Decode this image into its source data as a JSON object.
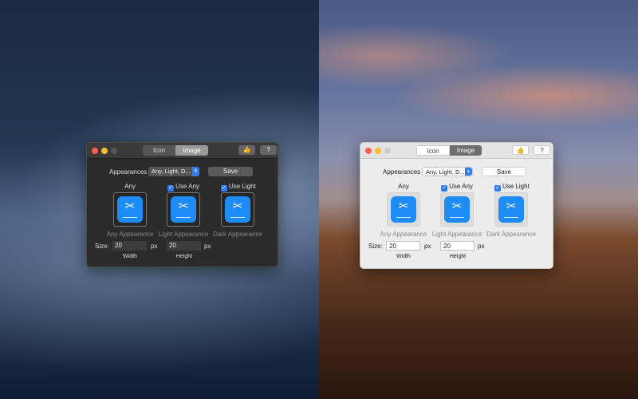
{
  "windows": {
    "dark": {
      "tabs": [
        "Icon",
        "Image"
      ],
      "selected_tab": "Image",
      "like_icon": "thumbs-up-icon",
      "help_icon": "question-icon",
      "appearances_label": "Appearances",
      "appearances_value": "Any, Light, D...",
      "save_label": "Save",
      "columns": [
        {
          "header": "Any",
          "checkbox": false,
          "caption": "Any Appearance"
        },
        {
          "header": "Use Any",
          "checkbox": true,
          "caption": "Light Appearance"
        },
        {
          "header": "Use Light",
          "checkbox": true,
          "caption": "Dark Appearance"
        }
      ],
      "size_label": "Size:",
      "width_value": "20",
      "height_value": "20",
      "unit": "px",
      "width_label": "Width",
      "height_label": "Height"
    },
    "light": {
      "tabs": [
        "Icon",
        "Image"
      ],
      "selected_tab": "Image",
      "like_icon": "thumbs-up-icon",
      "help_icon": "question-icon",
      "appearances_label": "Appearances",
      "appearances_value": "Any, Light, D...",
      "save_label": "Save",
      "columns": [
        {
          "header": "Any",
          "checkbox": false,
          "caption": "Any Appearance"
        },
        {
          "header": "Use Any",
          "checkbox": true,
          "caption": "Light Appearance"
        },
        {
          "header": "Use Light",
          "checkbox": true,
          "caption": "Dark Appearance"
        }
      ],
      "size_label": "Size:",
      "width_value": "20",
      "height_value": "20",
      "unit": "px",
      "width_label": "Width",
      "height_label": "Height"
    }
  },
  "colors": {
    "accent": "#2f7cf6",
    "icon_blue": "#1e8cf7",
    "close": "#fe5f57",
    "minimize": "#febc2e"
  }
}
